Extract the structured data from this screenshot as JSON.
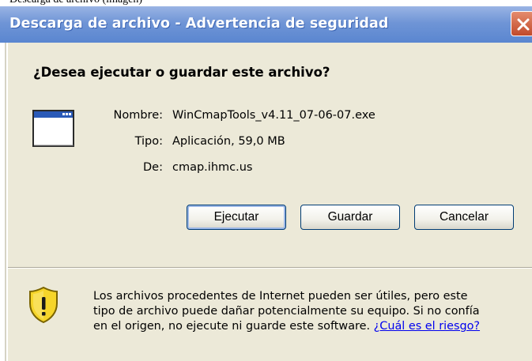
{
  "window": {
    "title": "Descarga de archivo - Advertencia de seguridad"
  },
  "dialog": {
    "question": "¿Desea ejecutar o guardar este archivo?",
    "file_info": {
      "name_label": "Nombre:",
      "name_value": "WinCmapTools_v4.11_07-06-07.exe",
      "type_label": "Tipo:",
      "type_value": "Aplicación, 59,0 MB",
      "from_label": "De:",
      "from_value": "cmap.ihmc.us"
    },
    "buttons": {
      "run": "Ejecutar",
      "save": "Guardar",
      "cancel": "Cancelar"
    },
    "warning": {
      "line1": "Los archivos procedentes de Internet pueden ser útiles, pero este",
      "line2": "tipo de archivo puede dañar potencialmente su equipo. Si no confía",
      "line3_prefix": "en el origen, no ejecute ni guarde este software.",
      "link": "¿Cuál es el riesgo?"
    }
  },
  "icons": {
    "file": "application-window-icon",
    "warning": "security-shield-warning-icon",
    "close": "close-icon"
  },
  "colors": {
    "titlebar": "#6f95d6",
    "close_button": "#c24a2b",
    "dialog_background": "#ece9d8",
    "button_border": "#003c74",
    "link": "#0000ee"
  }
}
